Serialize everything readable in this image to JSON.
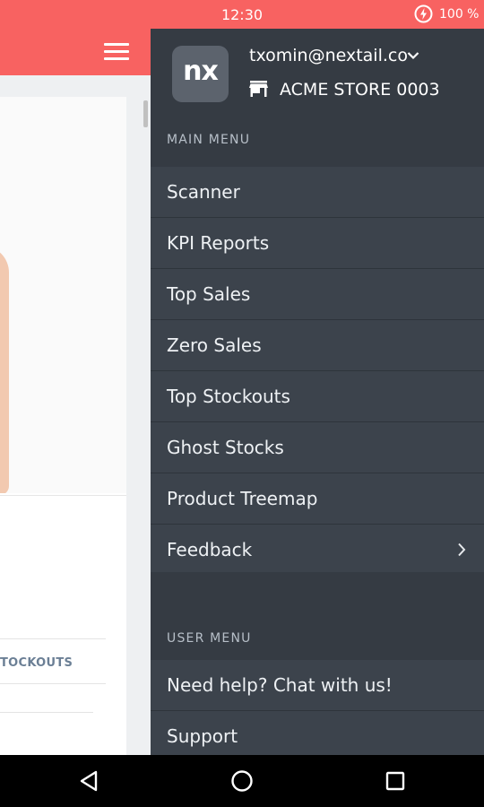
{
  "status_bar": {
    "time": "12:30",
    "battery": "100 %"
  },
  "background": {
    "tab_label": "TOCKOUTS"
  },
  "drawer": {
    "logo_text": "nx",
    "user_email": "txomin@nextail.co",
    "store_name": "ACME STORE 0003",
    "main_menu_title": "MAIN MENU",
    "main_menu": [
      {
        "label": "Scanner"
      },
      {
        "label": "KPI Reports"
      },
      {
        "label": "Top Sales"
      },
      {
        "label": "Zero Sales"
      },
      {
        "label": "Top Stockouts"
      },
      {
        "label": "Ghost Stocks"
      },
      {
        "label": "Product Treemap"
      },
      {
        "label": "Feedback"
      }
    ],
    "user_menu_title": "USER MENU",
    "user_menu": [
      {
        "label": "Need help? Chat with us!"
      },
      {
        "label": "Support"
      }
    ]
  },
  "icons": {
    "battery": "battery-charging-icon",
    "menu": "hamburger-menu-icon",
    "account_dropdown": "chevron-down-icon",
    "store": "store-icon",
    "submenu": "chevron-right-icon",
    "nav_back": "back-triangle-icon",
    "nav_home": "home-circle-icon",
    "nav_recent": "recent-apps-square-icon"
  },
  "colors": {
    "accent": "#f86261",
    "drawer_bg": "#3c434c",
    "drawer_header_bg": "#353b43",
    "section_title": "#b7bfc8"
  }
}
